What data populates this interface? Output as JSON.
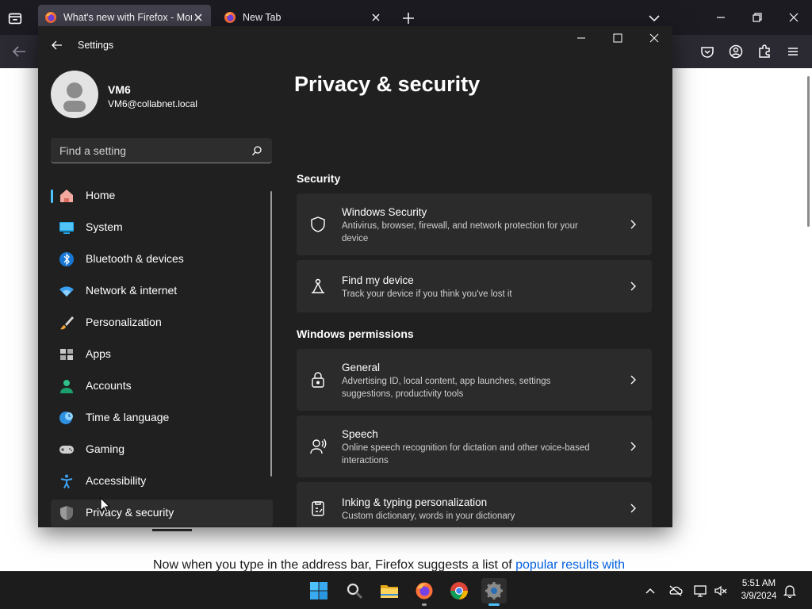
{
  "browser": {
    "tabs": [
      {
        "title": "What's new with Firefox - More",
        "active": true
      },
      {
        "title": "New Tab",
        "active": false
      }
    ],
    "page": {
      "text_before_link": "Now when you type in the address bar, Firefox suggests a list of ",
      "link_text": "popular results with"
    }
  },
  "settings": {
    "window_title": "Settings",
    "user": {
      "name": "VM6",
      "email": "VM6@collabnet.local"
    },
    "search_placeholder": "Find a setting",
    "nav": [
      {
        "label": "Home",
        "icon": "home-icon"
      },
      {
        "label": "System",
        "icon": "system-icon"
      },
      {
        "label": "Bluetooth & devices",
        "icon": "bluetooth-icon"
      },
      {
        "label": "Network & internet",
        "icon": "wifi-icon"
      },
      {
        "label": "Personalization",
        "icon": "brush-icon"
      },
      {
        "label": "Apps",
        "icon": "apps-icon"
      },
      {
        "label": "Accounts",
        "icon": "accounts-icon"
      },
      {
        "label": "Time & language",
        "icon": "globe-clock-icon"
      },
      {
        "label": "Gaming",
        "icon": "gamepad-icon"
      },
      {
        "label": "Accessibility",
        "icon": "accessibility-icon"
      },
      {
        "label": "Privacy & security",
        "icon": "shield-icon",
        "selected": true
      }
    ],
    "page_title": "Privacy & security",
    "sections": [
      {
        "heading": "Security",
        "cards": [
          {
            "title": "Windows Security",
            "description": "Antivirus, browser, firewall, and network protection for your device",
            "icon": "shield-outline-icon"
          },
          {
            "title": "Find my device",
            "description": "Track your device if you think you've lost it",
            "icon": "find-device-icon"
          }
        ]
      },
      {
        "heading": "Windows permissions",
        "cards": [
          {
            "title": "General",
            "description": "Advertising ID, local content, app launches, settings suggestions, productivity tools",
            "icon": "lock-icon"
          },
          {
            "title": "Speech",
            "description": "Online speech recognition for dictation and other voice-based interactions",
            "icon": "speech-icon"
          },
          {
            "title": "Inking & typing personalization",
            "description": "Custom dictionary, words in your dictionary",
            "icon": "clipboard-pen-icon"
          }
        ]
      }
    ]
  },
  "taskbar": {
    "clock": {
      "time": "5:51 AM",
      "date": "3/9/2024"
    },
    "apps": [
      "start-icon",
      "search-icon",
      "file-explorer-icon",
      "firefox-icon",
      "chrome-icon",
      "settings-gear-icon"
    ]
  },
  "colors": {
    "accent": "#4cc2ff",
    "settings_bg": "#202020",
    "card_bg": "#2b2b2b",
    "link": "#0060df"
  }
}
